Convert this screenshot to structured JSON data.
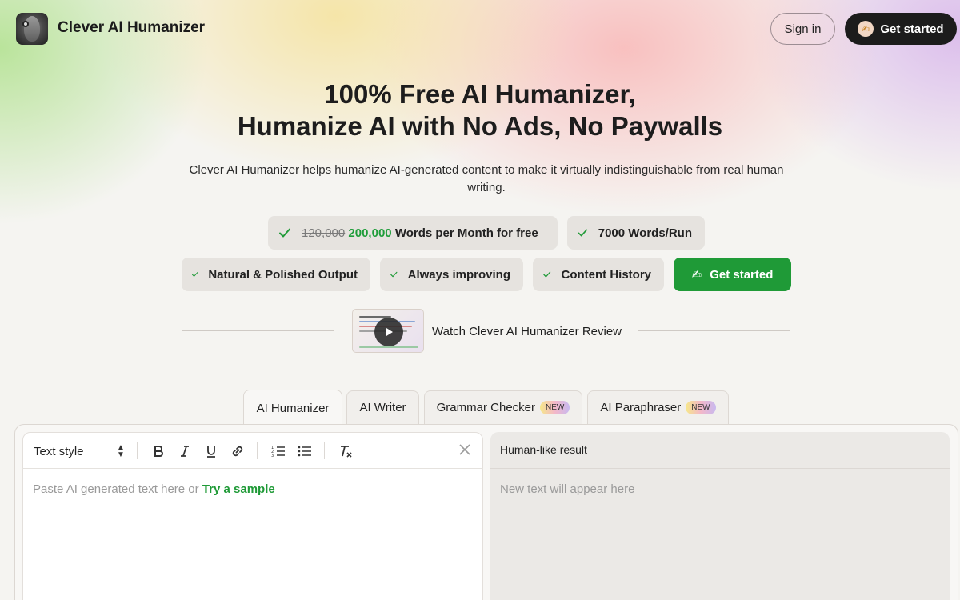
{
  "header": {
    "brand": "Clever AI Humanizer",
    "signin_label": "Sign in",
    "get_started_label": "Get started"
  },
  "hero": {
    "title_line1": "100% Free AI Humanizer,",
    "title_line2": "Humanize AI with No Ads, No Paywalls",
    "subtitle": "Clever AI Humanizer helps humanize AI-generated content to make it virtually indistinguishable from real human writing."
  },
  "features": {
    "words_old": "120,000",
    "words_new": "200,000",
    "words_suffix": "Words per Month for free",
    "per_run": "7000 Words/Run",
    "natural": "Natural & Polished Output",
    "improving": "Always improving",
    "history": "Content History",
    "cta_label": "Get started",
    "cta_emoji": "✍"
  },
  "video": {
    "label": "Watch Clever AI Humanizer Review"
  },
  "tabs": [
    {
      "label": "AI Humanizer",
      "active": true
    },
    {
      "label": "AI Writer"
    },
    {
      "label": "Grammar Checker",
      "badge": "NEW"
    },
    {
      "label": "AI Paraphraser",
      "badge": "NEW"
    }
  ],
  "editor": {
    "text_style_label": "Text style",
    "placeholder_prefix": "Paste AI generated text here or ",
    "try_sample_label": "Try a sample"
  },
  "result": {
    "title": "Human-like result",
    "placeholder": "New text will appear here"
  },
  "colors": {
    "accent_green": "#1f9a37",
    "dark_button": "#1c1c1c"
  }
}
